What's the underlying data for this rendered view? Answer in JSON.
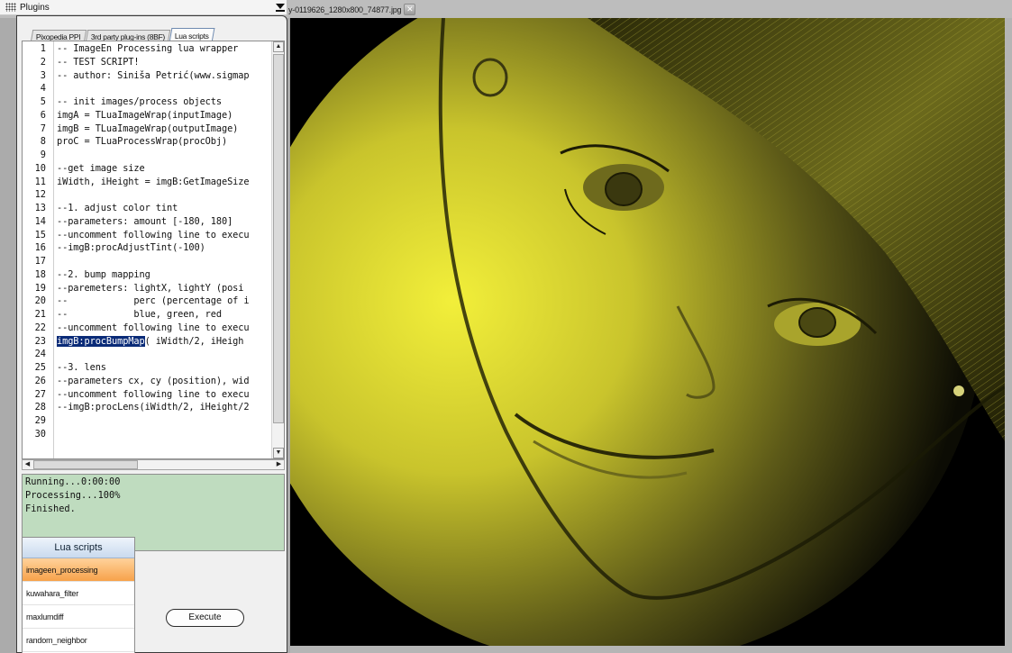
{
  "panel": {
    "title": "Plugins",
    "tabs": [
      {
        "label": "Pixopedia PPI",
        "active": false
      },
      {
        "label": "3rd party plug-ins (8BF)",
        "active": false
      },
      {
        "label": "Lua scripts",
        "active": true
      }
    ]
  },
  "document_tab": {
    "label": "y-0119626_1280x800_74877.jpg",
    "close_icon": "close-icon"
  },
  "editor": {
    "lines": [
      "-- ImageEn Processing lua wrapper",
      "-- TEST SCRIPT!",
      "-- author: Siniša Petrić(www.sigmap",
      "",
      "-- init images/process objects",
      "imgA = TLuaImageWrap(inputImage)",
      "imgB = TLuaImageWrap(outputImage)",
      "proC = TLuaProcessWrap(procObj)",
      "",
      "--get image size",
      "iWidth, iHeight = imgB:GetImageSize",
      "",
      "--1. adjust color tint",
      "--parameters: amount [-180, 180]",
      "--uncomment following line to execu",
      "--imgB:procAdjustTint(-100)",
      "",
      "--2. bump mapping",
      "--paremeters: lightX, lightY (posi",
      "--            perc (percentage of i",
      "--            blue, green, red",
      "--uncomment following line to execu",
      "imgB:procBumpMap( iWidth/2, iHeigh",
      "",
      "--3. lens",
      "--parameters cx, cy (position), wid",
      "--uncomment following line to execu",
      "--imgB:procLens(iWidth/2, iHeight/2",
      "",
      ""
    ],
    "line_numbers": [
      "1",
      "2",
      "3",
      "4",
      "5",
      "6",
      "7",
      "8",
      "9",
      "10",
      "11",
      "12",
      "13",
      "14",
      "15",
      "16",
      "17",
      "18",
      "19",
      "20",
      "21",
      "22",
      "23",
      "24",
      "25",
      "26",
      "27",
      "28",
      "29",
      "30"
    ],
    "selection": {
      "line": 23,
      "text": "imgB:procBumpMap",
      "rest": "( iWidth/2, iHeigh"
    },
    "scroll_up_icon": "arrow-up-icon",
    "scroll_down_icon": "arrow-down-icon",
    "scroll_left_icon": "arrow-left-icon",
    "scroll_right_icon": "arrow-right-icon"
  },
  "console": {
    "lines": [
      "Running...0:00:00",
      "Processing...100%",
      "Finished."
    ]
  },
  "scripts": {
    "header": "Lua scripts",
    "items": [
      {
        "label": "imageen_processing",
        "selected": true
      },
      {
        "label": "kuwahara_filter",
        "selected": false
      },
      {
        "label": "maxlumdiff",
        "selected": false
      },
      {
        "label": "random_neighbor",
        "selected": false
      }
    ]
  },
  "execute_label": "Execute",
  "colors": {
    "console_bg": "#bfdcbf",
    "selection_bg": "#0a2b78",
    "image_tint": "#e3df2f",
    "selected_script": "#f7a24a"
  }
}
